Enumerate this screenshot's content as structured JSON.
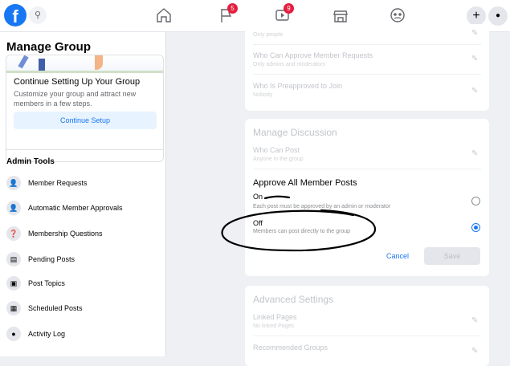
{
  "topbar": {
    "logo": "f",
    "search_icon": "⚲",
    "nav": [
      {
        "name": "home-icon"
      },
      {
        "name": "flag-icon",
        "badge": "5"
      },
      {
        "name": "watch-icon",
        "badge": "9"
      },
      {
        "name": "marketplace-icon"
      },
      {
        "name": "groups-icon"
      }
    ],
    "plus_icon": "+",
    "messenger_icon": "●"
  },
  "sidebar": {
    "title": "Manage Group",
    "card": {
      "title": "Continue Setting Up Your Group",
      "desc": "Customize your group and attract new members in a few steps.",
      "button": "Continue Setup"
    },
    "admin_title": "Admin Tools",
    "items": [
      {
        "label": "Member Requests",
        "icon": "👤"
      },
      {
        "label": "Automatic Member Approvals",
        "icon": "👤"
      },
      {
        "label": "Membership Questions",
        "icon": "❓"
      },
      {
        "label": "Pending Posts",
        "icon": "▤"
      },
      {
        "label": "Post Topics",
        "icon": "▣"
      },
      {
        "label": "Scheduled Posts",
        "icon": "▦"
      },
      {
        "label": "Activity Log",
        "icon": "●"
      }
    ]
  },
  "membership_panel": {
    "rows": [
      {
        "label": "Who Can Approve Member Requests",
        "sub": "Only admins and moderators"
      },
      {
        "label": "Who Is Preapproved to Join",
        "sub": "Nobody"
      }
    ],
    "top_sub": "Only people"
  },
  "discussion_panel": {
    "title": "Manage Discussion",
    "who_can_post": {
      "label": "Who Can Post",
      "sub": "Anyone in the group"
    },
    "approve_title": "Approve All Member Posts",
    "options": [
      {
        "label": "On",
        "desc": "Each post must be approved by an admin or moderator",
        "selected": false
      },
      {
        "label": "Off",
        "desc": "Members can post directly to the group",
        "selected": true
      }
    ],
    "cancel": "Cancel",
    "save": "Save"
  },
  "advanced_panel": {
    "title": "Advanced Settings",
    "rows": [
      {
        "label": "Linked Pages",
        "sub": "No linked Pages"
      },
      {
        "label": "Recommended Groups",
        "sub": ""
      }
    ]
  },
  "colors": {
    "accent": "#1877f2",
    "badge": "#e41e3f",
    "annotation": "#000000"
  }
}
